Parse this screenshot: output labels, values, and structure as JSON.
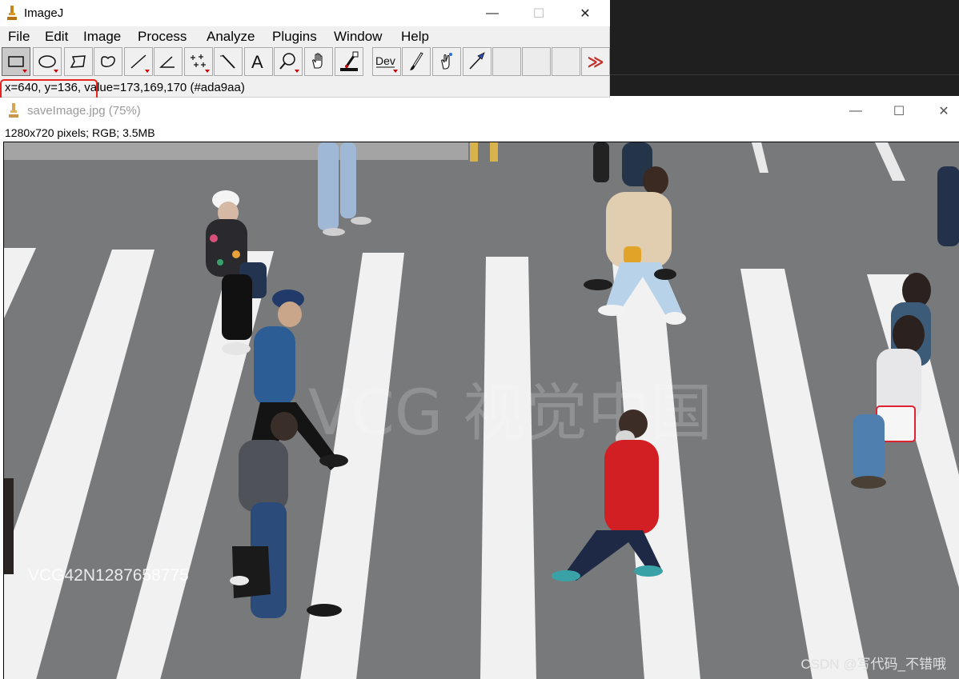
{
  "main_window": {
    "title": "ImageJ",
    "menu": [
      "File",
      "Edit",
      "Image",
      "Process",
      "Analyze",
      "Plugins",
      "Window",
      "Help"
    ],
    "tools": [
      {
        "name": "rectangle-tool-icon",
        "selected": true,
        "has_menu": true
      },
      {
        "name": "oval-tool-icon",
        "has_menu": true
      },
      {
        "name": "polygon-tool-icon"
      },
      {
        "name": "freehand-tool-icon"
      },
      {
        "name": "line-tool-icon",
        "has_menu": true
      },
      {
        "name": "angle-tool-icon"
      },
      {
        "name": "point-tool-icon",
        "has_menu": true
      },
      {
        "name": "wand-tool-icon"
      },
      {
        "name": "text-tool-icon"
      },
      {
        "name": "zoom-tool-icon",
        "has_menu": true
      },
      {
        "name": "hand-tool-icon"
      },
      {
        "name": "color-picker-icon"
      },
      {
        "name": "dev-menu-icon",
        "label": "Dev",
        "has_menu": true
      },
      {
        "name": "brush-tool-icon"
      },
      {
        "name": "flood-fill-icon"
      },
      {
        "name": "arrow-tool-icon"
      },
      {
        "name": "empty-slot-1"
      },
      {
        "name": "empty-slot-2"
      },
      {
        "name": "empty-slot-3"
      },
      {
        "name": "more-tools-icon",
        "label": "≫"
      }
    ],
    "status": "x=640, y=136, value=173,169,170 (#ada9aa)"
  },
  "image_window": {
    "title": "saveImage.jpg (75%)",
    "info": "1280x720 pixels; RGB; 3.5MB",
    "overlay_id": "VCG42N1287658775",
    "csdn_watermark": "CSDN @写代码_不错哦"
  },
  "colors": {
    "highlight": "#e8241d",
    "road": "#77787a",
    "stripe": "#f2f2f2",
    "window_bg": "#f0f0f0"
  }
}
